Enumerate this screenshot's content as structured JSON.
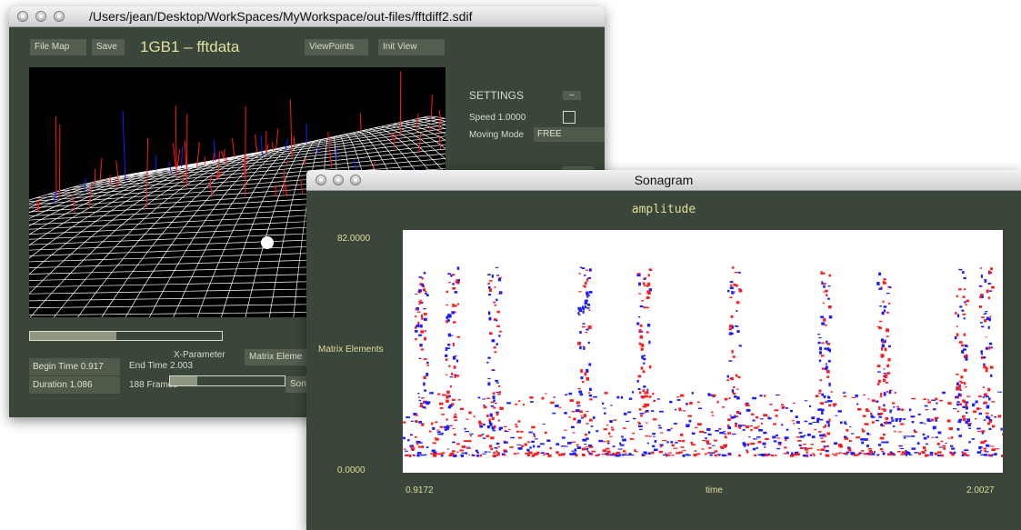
{
  "main_window": {
    "title": "/Users/jean/Desktop/WorkSpaces/MyWorkspace/out-files/fftdiff2.sdif",
    "toolbar": {
      "file_map": "File Map",
      "save": "Save",
      "dataset_title": "1GB1 – fftdata",
      "view_points": "ViewPoints",
      "init_view": "Init View"
    },
    "settings": {
      "heading": "SETTINGS",
      "collapse": "–",
      "speed_label": "Speed 1.0000",
      "moving_mode_label": "Moving Mode",
      "moving_mode_value": "FREE"
    },
    "timeline": {
      "progress": 0.45,
      "begin_time": "Begin Time 0.917",
      "end_time": "End Time 2.003",
      "duration": "Duration 1.086",
      "frames": "188 Frames",
      "x_parameter": "X-Parameter",
      "matrix_elements": "Matrix Eleme",
      "son_button": "Son"
    }
  },
  "sonagram_window": {
    "title": "Sonagram",
    "plot_title": "amplitude",
    "y_max": "82.0000",
    "y_min": "0.0000",
    "y_label": "Matrix Elements",
    "x_min": "0.9172",
    "x_max": "2.0027",
    "x_label": "time"
  },
  "colors": {
    "panel_bg": "#3a4639",
    "button_bg": "#535e4f",
    "label_text": "#d9dccb",
    "sonagram_text": "#e2dd9c",
    "positive": "#ff1b1b",
    "negative": "#1c1cff"
  }
}
